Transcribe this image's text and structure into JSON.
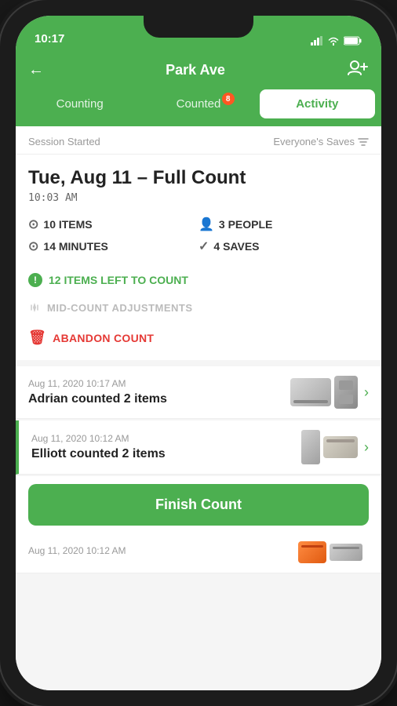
{
  "status_bar": {
    "time": "10:17"
  },
  "nav": {
    "back_label": "←",
    "title": "Park Ave",
    "add_icon": "add-person"
  },
  "tabs": [
    {
      "id": "counting",
      "label": "Counting",
      "badge": null
    },
    {
      "id": "counted",
      "label": "Counted",
      "badge": "8"
    },
    {
      "id": "activity",
      "label": "Activity",
      "active": true,
      "badge": null
    }
  ],
  "session_header": {
    "left": "Session Started",
    "right": "Everyone's Saves"
  },
  "session": {
    "date": "Tue, Aug 11 – Full Count",
    "time": "10:03 AM",
    "stats": [
      {
        "icon": "layers",
        "value": "10 ITEMS"
      },
      {
        "icon": "people",
        "value": "3 PEOPLE"
      },
      {
        "icon": "clock",
        "value": "14 MINUTES"
      },
      {
        "icon": "check",
        "value": "4 SAVES"
      }
    ],
    "alert": "12 ITEMS LEFT TO COUNT",
    "mid_count_label": "MID-COUNT ADJUSTMENTS",
    "abandon_label": "ABANDON COUNT"
  },
  "activity_items": [
    {
      "date": "Aug 11, 2020 10:17 AM",
      "description": "Adrian counted 2 items",
      "has_accent": false
    },
    {
      "date": "Aug 11, 2020 10:12 AM",
      "description": "Elliott counted 2 items",
      "has_accent": true
    }
  ],
  "bottom_peek": {
    "date": "Aug 11, 2020 10:12 AM"
  },
  "finish_button": {
    "label": "Finish Count"
  }
}
